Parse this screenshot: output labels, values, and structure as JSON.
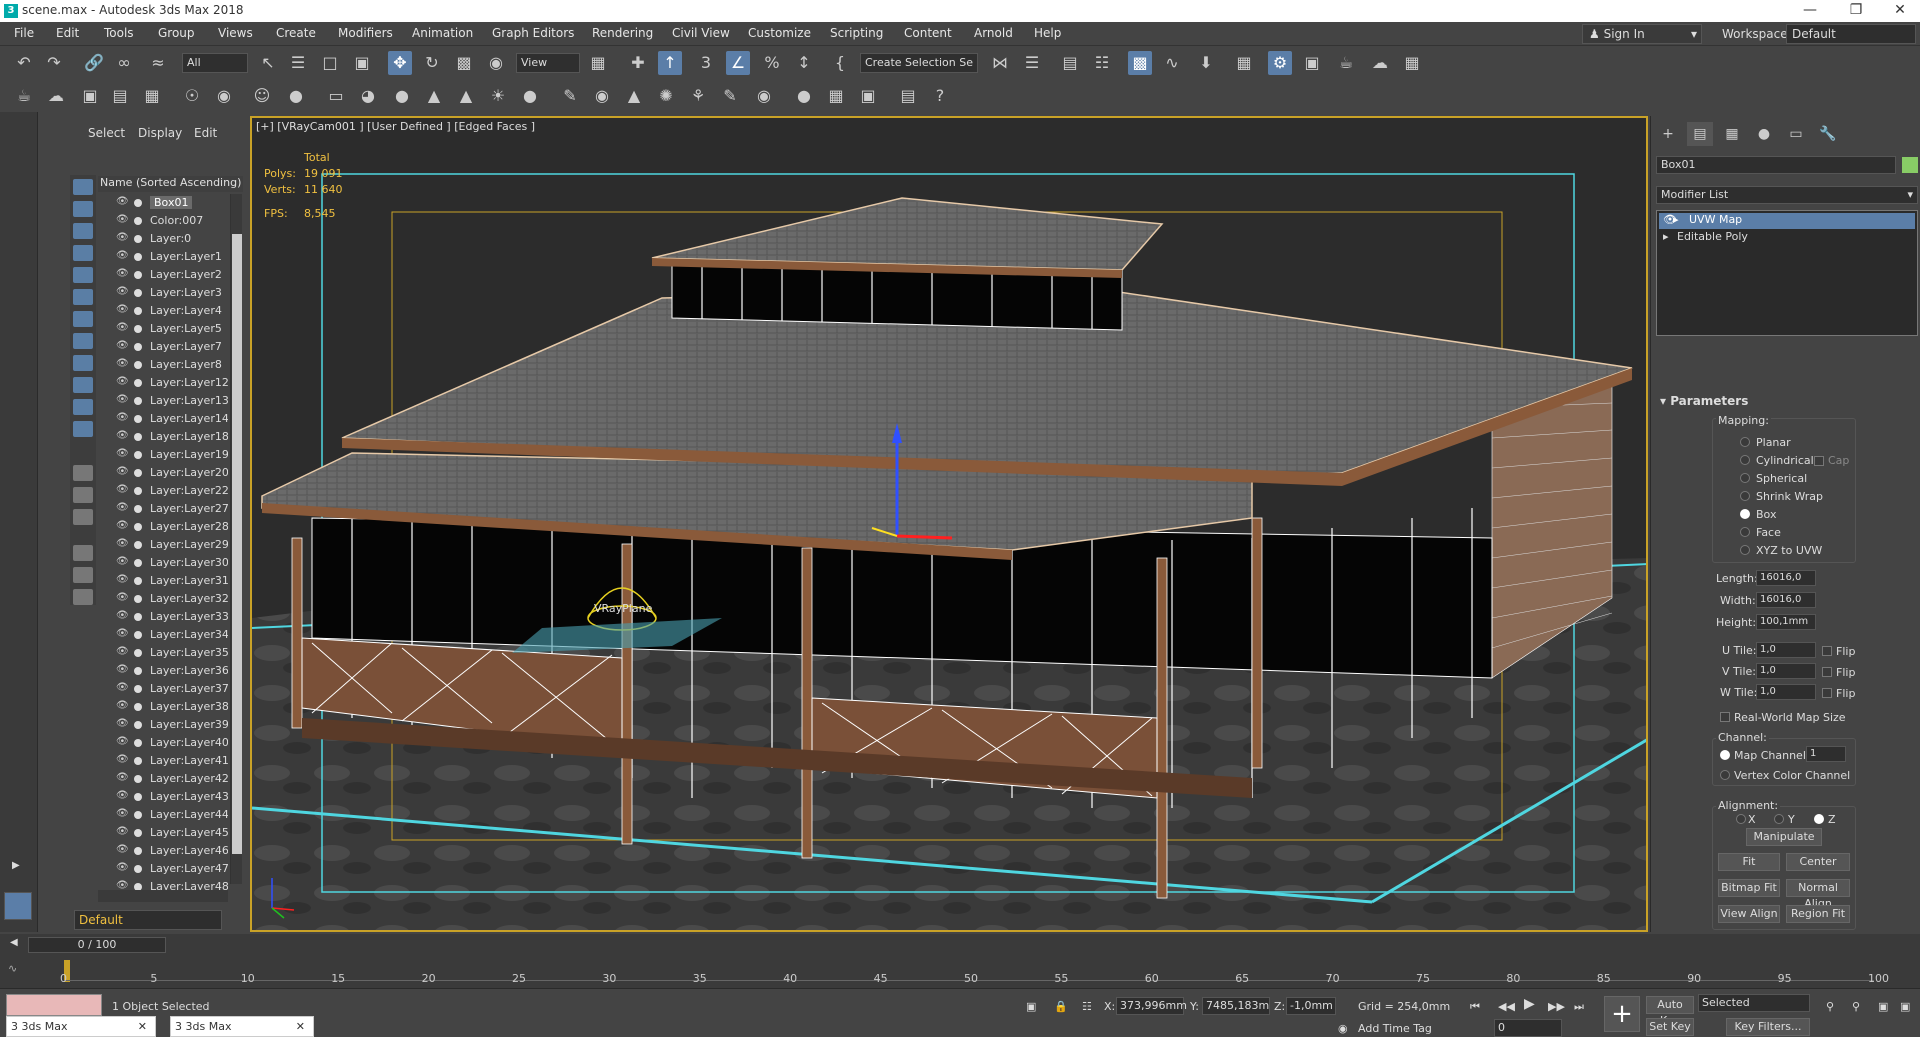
{
  "window": {
    "title": "scene.max - Autodesk 3ds Max 2018",
    "app_icon": "3ds-max-icon"
  },
  "menu": [
    "File",
    "Edit",
    "Tools",
    "Group",
    "Views",
    "Create",
    "Modifiers",
    "Animation",
    "Graph Editors",
    "Rendering",
    "Civil View",
    "Customize",
    "Scripting",
    "Content",
    "Arnold",
    "Help"
  ],
  "account": {
    "sign_in": "Sign In",
    "workspaces_label": "Workspaces:",
    "workspace": "Default"
  },
  "toolbar": {
    "selection_filter": "All",
    "ref_coord": "View",
    "named_selection": "Create Selection Se"
  },
  "scene_explorer": {
    "tabs": [
      "Select",
      "Display",
      "Edit"
    ],
    "column_header": "Name (Sorted Ascending)",
    "items": [
      "Box01",
      "Color:007",
      "Layer:0",
      "Layer:Layer1",
      "Layer:Layer2",
      "Layer:Layer3",
      "Layer:Layer4",
      "Layer:Layer5",
      "Layer:Layer7",
      "Layer:Layer8",
      "Layer:Layer12",
      "Layer:Layer13",
      "Layer:Layer14",
      "Layer:Layer18",
      "Layer:Layer19",
      "Layer:Layer20",
      "Layer:Layer22",
      "Layer:Layer27",
      "Layer:Layer28",
      "Layer:Layer29",
      "Layer:Layer30",
      "Layer:Layer31",
      "Layer:Layer32",
      "Layer:Layer33",
      "Layer:Layer34",
      "Layer:Layer35",
      "Layer:Layer36",
      "Layer:Layer37",
      "Layer:Layer38",
      "Layer:Layer39",
      "Layer:Layer40",
      "Layer:Layer41",
      "Layer:Layer42",
      "Layer:Layer43",
      "Layer:Layer44",
      "Layer:Layer45",
      "Layer:Layer46",
      "Layer:Layer47",
      "Layer:Layer48"
    ],
    "selected": "Box01",
    "layer": "Default"
  },
  "viewport": {
    "label": "[+] [VRayCam001 ] [User Defined ] [Edged Faces ]",
    "stats": {
      "total_label": "Total",
      "polys_label": "Polys:",
      "polys": "19 091",
      "verts_label": "Verts:",
      "verts": "11 640",
      "fps_label": "FPS:",
      "fps": "8,545"
    },
    "plane_label": "VRayPlane",
    "colors": {
      "frame": "#c9a227",
      "safe_frame": "#4fd6e0",
      "roof": "#6b6b6b",
      "wood": "#8a5a3a",
      "wire": "#ffffff",
      "ground": "#3c3c3c"
    }
  },
  "command_panel": {
    "object_name": "Box01",
    "modifier_list": "Modifier List",
    "stack": [
      "UVW Map",
      "Editable Poly"
    ],
    "parameters": {
      "title": "Parameters",
      "mapping_label": "Mapping:",
      "mapping_options": [
        "Planar",
        "Cylindrical",
        "Spherical",
        "Shrink Wrap",
        "Box",
        "Face",
        "XYZ to UVW"
      ],
      "mapping_selected": "Box",
      "cap_label": "Cap",
      "length_label": "Length:",
      "length": "16016,0",
      "width_label": "Width:",
      "width": "16016,0",
      "height_label": "Height:",
      "height": "100,1mm",
      "utile_label": "U Tile:",
      "utile": "1,0",
      "vtile_label": "V Tile:",
      "vtile": "1,0",
      "wtile_label": "W Tile:",
      "wtile": "1,0",
      "flip_label": "Flip",
      "real_world": "Real-World Map Size",
      "channel_label": "Channel:",
      "map_channel_label": "Map Channel:",
      "map_channel": "1",
      "vertex_color_channel": "Vertex Color Channel",
      "alignment_label": "Alignment:",
      "axes": [
        "X",
        "Y",
        "Z"
      ],
      "axis_selected": "Z",
      "buttons": {
        "manipulate": "Manipulate",
        "fit": "Fit",
        "center": "Center",
        "bitmap_fit": "Bitmap Fit",
        "normal_align": "Normal Align",
        "view_align": "View Align",
        "region_fit": "Region Fit"
      }
    }
  },
  "timeline": {
    "slider": "0 / 100",
    "ticks": [
      "0",
      "5",
      "10",
      "15",
      "20",
      "25",
      "30",
      "35",
      "40",
      "45",
      "50",
      "55",
      "60",
      "65",
      "70",
      "75",
      "80",
      "85",
      "90",
      "95",
      "100"
    ]
  },
  "status": {
    "message": "1 Object Selected",
    "x_label": "X:",
    "x": "373,996mm",
    "y_label": "Y:",
    "y": "7485,183m",
    "z_label": "Z:",
    "z": "-1,0mm",
    "grid": "Grid = 254,0mm",
    "add_time_tag": "Add Time Tag",
    "auto_key": "Auto Key",
    "set_key": "Set Key",
    "key_mode": "Selected",
    "key_filters": "Key Filters...",
    "frame": "0"
  },
  "taskbar": [
    "3ds Max",
    "3ds Max"
  ]
}
